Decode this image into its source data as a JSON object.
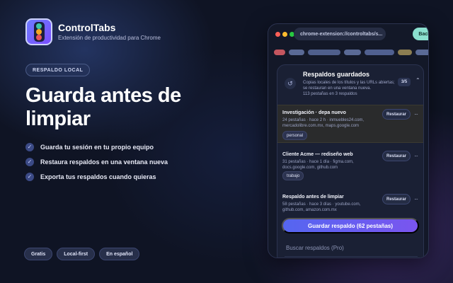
{
  "app": {
    "name": "ControlTabs",
    "tagline": "Extensión de productividad para Chrome",
    "logo_dot_colors": [
      "#3ec7a9",
      "#f5a623",
      "#e8525a"
    ]
  },
  "hero": {
    "chip": "RESPALDO LOCAL",
    "headline": "Guarda antes de limpiar",
    "features": [
      "Guarda tu sesión en tu propio equipo",
      "Restaura respaldos en una ventana nueva",
      "Exporta tus respaldos cuando quieras"
    ],
    "pills": [
      "Gratis",
      "Local-first",
      "En español"
    ]
  },
  "browser": {
    "traffic_light_colors": [
      "#ff5f57",
      "#febc2e",
      "#28c840"
    ],
    "url": "chrome-extension://controltabs/s...",
    "backup_button": "Backup local",
    "tab_colors": [
      "#c4565f",
      "#5a6a96",
      "#4f5f8c",
      "#5a6a96",
      "#506090",
      "#8c7e52",
      "#5a6a96"
    ]
  },
  "popup": {
    "title": "Respaldos guardados",
    "description": "Copias locales de los títulos y las URLs abiertas; se restauran en una ventana nueva.",
    "count_summary": "113 pestañas en 3 respaldos",
    "count_badge": "3/5",
    "items": [
      {
        "title": "Investigación · depa nuevo",
        "meta": "24 pestañas · hace 2 h · inmuebles24.com, mercadolibre.com.mx, maps.google.com",
        "restore": "Restaurar",
        "tag": "personal"
      },
      {
        "title": "Cliente Acme — rediseño web",
        "meta": "31 pestañas · hace 1 día · figma.com, docs.google.com, github.com",
        "restore": "Restaurar",
        "tag": "trabajo"
      },
      {
        "title": "Respaldo antes de limpiar",
        "meta": "58 pestañas · hace 3 días · youtube.com, github.com, amazon.com.mx",
        "restore": "Restaurar",
        "tag": ""
      }
    ],
    "save_button": "Guardar respaldo (62 pestañas)",
    "search_placeholder": "Buscar respaldos (Pro)"
  }
}
